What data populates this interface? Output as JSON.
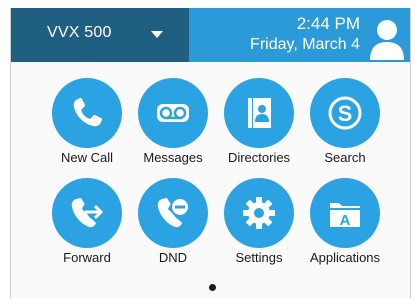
{
  "header": {
    "line_name": "VVX 500",
    "time": "2:44 PM",
    "date": "Friday, March 4"
  },
  "apps": [
    {
      "label": "New Call",
      "icon": "phone-icon"
    },
    {
      "label": "Messages",
      "icon": "voicemail-icon"
    },
    {
      "label": "Directories",
      "icon": "contacts-book-icon"
    },
    {
      "label": "Search",
      "icon": "skype-icon"
    },
    {
      "label": "Forward",
      "icon": "call-forward-icon"
    },
    {
      "label": "DND",
      "icon": "do-not-disturb-icon"
    },
    {
      "label": "Settings",
      "icon": "gear-icon"
    },
    {
      "label": "Applications",
      "icon": "applications-folder-icon"
    }
  ],
  "pager": {
    "current_page": 1
  },
  "colors": {
    "header_dark": "#1f5f82",
    "header_accent": "#2c9ad8",
    "icon_circle": "#2ba2e2"
  }
}
